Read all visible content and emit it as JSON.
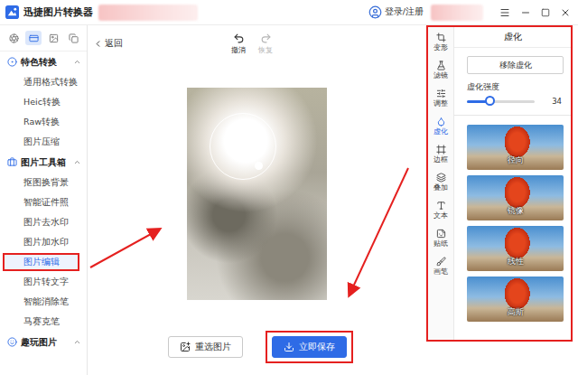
{
  "window": {
    "title": "迅捷图片转换器"
  },
  "account": {
    "label": "登录/注册"
  },
  "sidebar": {
    "tabs": [
      {
        "selected": false
      },
      {
        "selected": true
      },
      {
        "selected": false
      },
      {
        "selected": false
      }
    ],
    "sections": [
      {
        "title": "特色转换",
        "expanded": true,
        "items": [
          {
            "label": "通用格式转换",
            "selected": false,
            "highlighted": false
          },
          {
            "label": "Heic转换",
            "selected": false,
            "highlighted": false
          },
          {
            "label": "Raw转换",
            "selected": false,
            "highlighted": false
          },
          {
            "label": "图片压缩",
            "selected": false,
            "highlighted": false
          }
        ]
      },
      {
        "title": "图片工具箱",
        "expanded": true,
        "items": [
          {
            "label": "抠图换背景",
            "selected": false,
            "highlighted": false
          },
          {
            "label": "智能证件照",
            "selected": false,
            "highlighted": false
          },
          {
            "label": "图片去水印",
            "selected": false,
            "highlighted": false
          },
          {
            "label": "图片加水印",
            "selected": false,
            "highlighted": false
          },
          {
            "label": "图片编辑",
            "selected": true,
            "highlighted": true
          },
          {
            "label": "图片转文字",
            "selected": false,
            "highlighted": false
          },
          {
            "label": "智能消除笔",
            "selected": false,
            "highlighted": false
          },
          {
            "label": "马赛克笔",
            "selected": false,
            "highlighted": false
          }
        ]
      },
      {
        "title": "趣玩图片",
        "expanded": true,
        "items": []
      }
    ]
  },
  "editor": {
    "back": "返回",
    "history": [
      {
        "label": "撤消",
        "disabled": false
      },
      {
        "label": "恢复",
        "disabled": true
      }
    ],
    "buttons": [
      {
        "label": "重选图片",
        "primary": false,
        "highlighted": false
      },
      {
        "label": "立即保存",
        "primary": true,
        "highlighted": true
      }
    ]
  },
  "tools": [
    {
      "label": "变形",
      "selected": false
    },
    {
      "label": "滤镜",
      "selected": false
    },
    {
      "label": "调整",
      "selected": false
    },
    {
      "label": "虚化",
      "selected": true
    },
    {
      "label": "边框",
      "selected": false
    },
    {
      "label": "叠加",
      "selected": false
    },
    {
      "label": "文本",
      "selected": false
    },
    {
      "label": "贴纸",
      "selected": false
    },
    {
      "label": "画笔",
      "selected": false
    }
  ],
  "panel": {
    "title": "虚化",
    "highlighted": true,
    "action": "移除虚化",
    "slider": {
      "label": "虚化强度",
      "level": 0.34,
      "reading": "34"
    },
    "presets": [
      {
        "label": "径向"
      },
      {
        "label": "镜像"
      },
      {
        "label": "线性"
      },
      {
        "label": "高斯"
      }
    ]
  }
}
